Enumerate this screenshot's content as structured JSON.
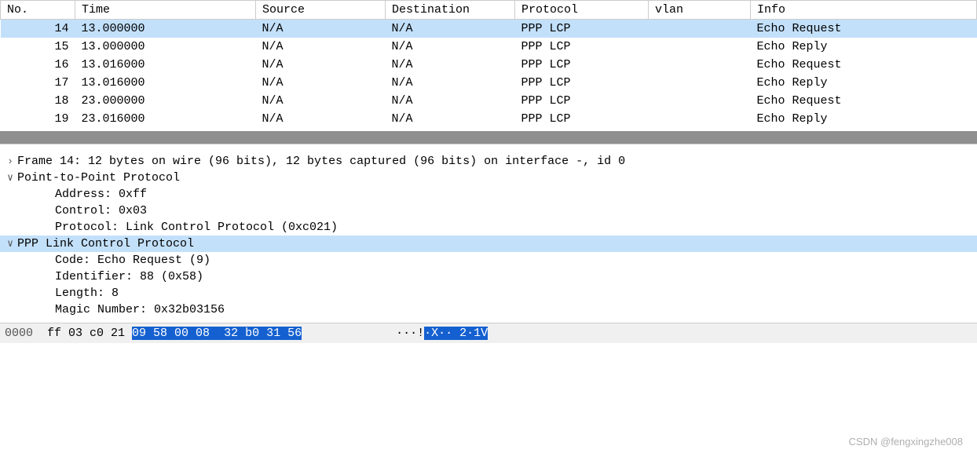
{
  "columns": {
    "no": "No.",
    "time": "Time",
    "source": "Source",
    "destination": "Destination",
    "protocol": "Protocol",
    "vlan": "vlan",
    "info": "Info"
  },
  "packets": [
    {
      "no": "14",
      "time": "13.000000",
      "source": "N/A",
      "dest": "N/A",
      "proto": "PPP LCP",
      "vlan": "",
      "info": "Echo Request",
      "selected": true
    },
    {
      "no": "15",
      "time": "13.000000",
      "source": "N/A",
      "dest": "N/A",
      "proto": "PPP LCP",
      "vlan": "",
      "info": "Echo Reply",
      "selected": false
    },
    {
      "no": "16",
      "time": "13.016000",
      "source": "N/A",
      "dest": "N/A",
      "proto": "PPP LCP",
      "vlan": "",
      "info": "Echo Request",
      "selected": false
    },
    {
      "no": "17",
      "time": "13.016000",
      "source": "N/A",
      "dest": "N/A",
      "proto": "PPP LCP",
      "vlan": "",
      "info": "Echo Reply",
      "selected": false
    },
    {
      "no": "18",
      "time": "23.000000",
      "source": "N/A",
      "dest": "N/A",
      "proto": "PPP LCP",
      "vlan": "",
      "info": "Echo Request",
      "selected": false
    },
    {
      "no": "19",
      "time": "23.016000",
      "source": "N/A",
      "dest": "N/A",
      "proto": "PPP LCP",
      "vlan": "",
      "info": "Echo Reply",
      "selected": false
    }
  ],
  "details": {
    "frame": "Frame 14: 12 bytes on wire (96 bits), 12 bytes captured (96 bits) on interface -, id 0",
    "ppp_header": "Point-to-Point Protocol",
    "ppp_address": "Address: 0xff",
    "ppp_control": "Control: 0x03",
    "ppp_protocol": "Protocol: Link Control Protocol (0xc021)",
    "lcp_header": "PPP Link Control Protocol",
    "lcp_code": "Code: Echo Request (9)",
    "lcp_identifier": "Identifier: 88 (0x58)",
    "lcp_length": "Length: 8",
    "lcp_magic": "Magic Number: 0x32b03156"
  },
  "hex": {
    "offset": "0000",
    "plain1": "ff 03 c0 21 ",
    "hl": "09 58 00 08  32 b0 31 56",
    "ascii_plain": "···!",
    "ascii_hl": "·X·· 2·1V"
  },
  "watermark": "CSDN @fengxingzhe008"
}
